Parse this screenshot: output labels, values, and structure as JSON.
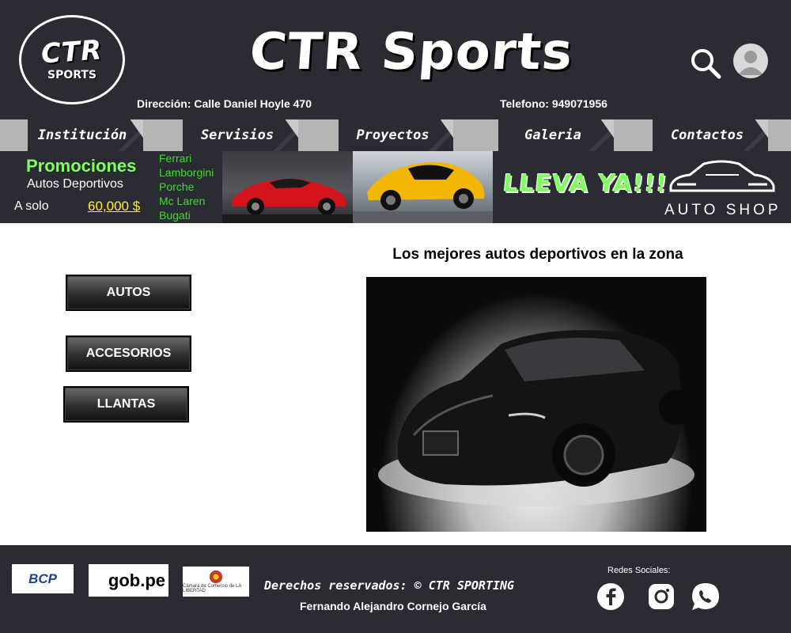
{
  "header": {
    "logo_main": "CTR",
    "logo_sub": "SPORTS",
    "title": "CTR Sports",
    "address": "Dirección: Calle Daniel Hoyle 470",
    "phone": "Telefono: 949071956"
  },
  "nav": {
    "items": [
      {
        "label": "Institución"
      },
      {
        "label": "Servisios"
      },
      {
        "label": "Proyectos"
      },
      {
        "label": "Galeria"
      },
      {
        "label": "Contactos"
      }
    ]
  },
  "banner": {
    "promo_title": "Promociones",
    "promo_subtitle": "Autos Deportivos",
    "price_prefix": "A solo",
    "price": "60,000 $",
    "brands": [
      "Ferrari",
      "Lamborgini",
      "Porche",
      "Mc Laren",
      "Bugati"
    ],
    "cta": "LLEVA YA!!!",
    "shop_name": "AUTO SHOP"
  },
  "sidebar": {
    "buttons": [
      {
        "label": "AUTOS"
      },
      {
        "label": "ACCESORIOS"
      },
      {
        "label": "LLANTAS"
      }
    ]
  },
  "main": {
    "heading": "Los mejores autos deportivos en la zona"
  },
  "footer": {
    "logos": [
      "BCP",
      "gob.pe",
      "Cámara de Comercio de LA LIBERTAD"
    ],
    "rights": "Derechos reservados: © CTR SPORTING",
    "author": "Fernando Alejandro Cornejo García",
    "social_label": "Redes Sociales:",
    "social": [
      "facebook-icon",
      "instagram-icon",
      "whatsapp-icon"
    ]
  },
  "colors": {
    "dark": "#2b2c33",
    "nav_gap": "#b5b5b5",
    "promo_green": "#7dff5c",
    "price_yellow": "#ffeb3b"
  }
}
